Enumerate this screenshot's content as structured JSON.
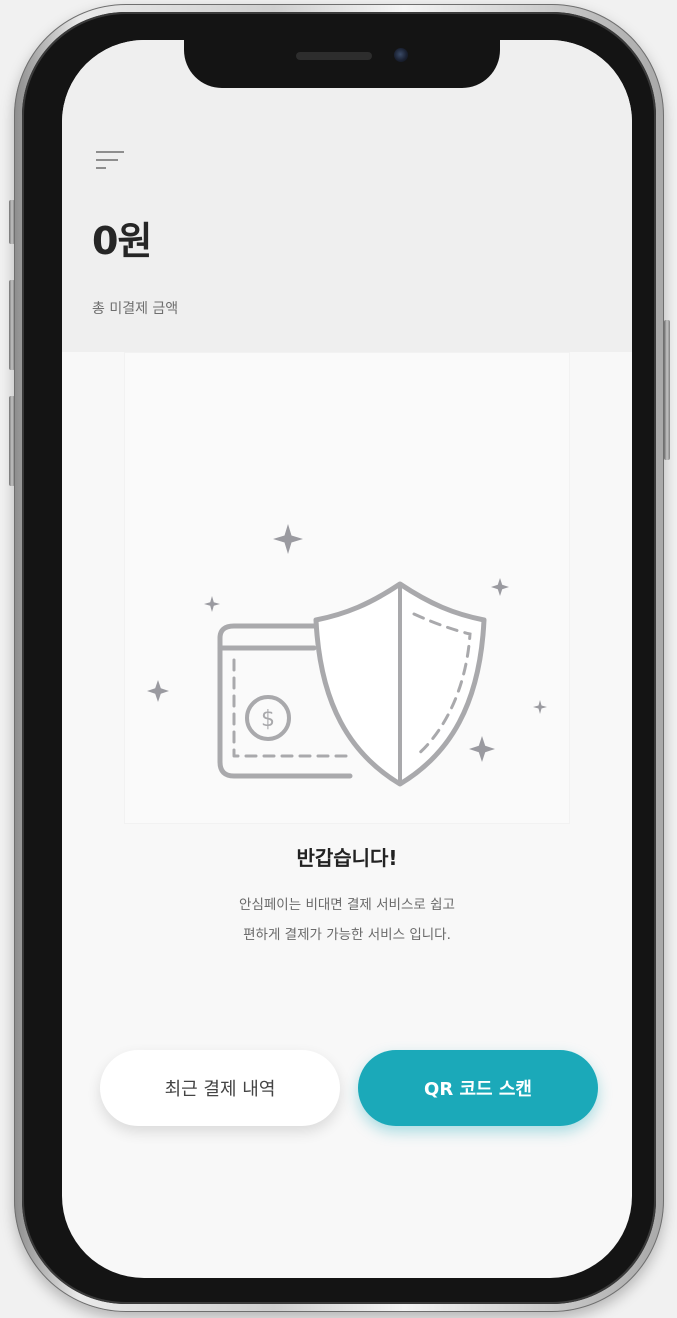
{
  "header": {
    "menu_icon": "hamburger-menu-icon",
    "total_amount": "0원",
    "total_amount_label": "총 미결제 금액"
  },
  "illustration": {
    "icons": [
      "wallet-card-icon",
      "dollar-coin-icon",
      "shield-icon",
      "sparkle-icon"
    ]
  },
  "welcome": {
    "title": "반갑습니다!",
    "description_line1": "안심페이는 비대면 결제 서비스로 쉽고",
    "description_line2": "편하게 결제가 가능한 서비스 입니다."
  },
  "actions": {
    "history_label": "최근 결제 내역",
    "scan_label": "QR 코드 스캔"
  },
  "colors": {
    "accent": "#1ba9b9",
    "header_bg": "#efefef",
    "screen_bg": "#f8f8f8",
    "illustration_stroke": "#a9a9ac",
    "title_text": "#222222",
    "body_text": "#6a6a6a"
  }
}
